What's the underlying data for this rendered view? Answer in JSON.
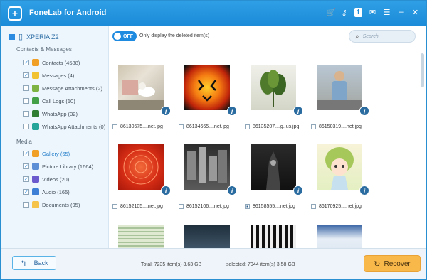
{
  "app": {
    "title": "FoneLab for Android",
    "logo": "+"
  },
  "titlebar": {
    "icons": [
      "cart-icon",
      "key-icon",
      "facebook-icon",
      "chat-icon",
      "menu-icon",
      "minimize-icon",
      "close-icon"
    ]
  },
  "device": {
    "name": "XPERIA Z2"
  },
  "sidebar": {
    "contacts_section": "Contacts & Messages",
    "media_section": "Media",
    "contacts_items": [
      {
        "label": "Contacts (4588)",
        "checked": true,
        "color": "#f1a027"
      },
      {
        "label": "Messages (4)",
        "checked": true,
        "color": "#f1c232"
      },
      {
        "label": "Message Attachments (2)",
        "checked": false,
        "color": "#7cb342"
      },
      {
        "label": "Call Logs (10)",
        "checked": false,
        "color": "#43a047"
      },
      {
        "label": "WhatsApp (32)",
        "checked": false,
        "color": "#2e7d32"
      },
      {
        "label": "WhatsApp Attachments (0)",
        "checked": false,
        "color": "#26a69a"
      }
    ],
    "media_items": [
      {
        "label": "Gallery (65)",
        "checked": true,
        "selected": true,
        "color": "#f1a027"
      },
      {
        "label": "Picture Library (1664)",
        "checked": true,
        "color": "#5c8fd6"
      },
      {
        "label": "Videos (20)",
        "checked": true,
        "color": "#6a5acd"
      },
      {
        "label": "Audio (165)",
        "checked": true,
        "color": "#3d7fd4"
      },
      {
        "label": "Documents (95)",
        "checked": false,
        "color": "#f5c24a"
      }
    ]
  },
  "toolbar": {
    "toggle_state": "OFF",
    "toggle_label": "Only display the deleted item(s)",
    "search_placeholder": "Search"
  },
  "files": [
    {
      "name": "86130575....net.jpg",
      "checked": false
    },
    {
      "name": "86134665....net.jpg",
      "checked": false
    },
    {
      "name": "86135207....g..us.jpg",
      "checked": false
    },
    {
      "name": "86150319....net.jpg",
      "checked": false
    },
    {
      "name": "86152105....net.jpg",
      "checked": false
    },
    {
      "name": "86152106....net.jpg",
      "checked": false
    },
    {
      "name": "86158555....net.jpg",
      "checked": true
    },
    {
      "name": "86170925....net.jpg",
      "checked": false
    }
  ],
  "footer": {
    "back_label": "Back",
    "total_label": "Total: 7235 item(s) 3.63 GB",
    "selected_label": "selected: 7044 item(s) 3.58 GB",
    "recover_label": "Recover"
  }
}
